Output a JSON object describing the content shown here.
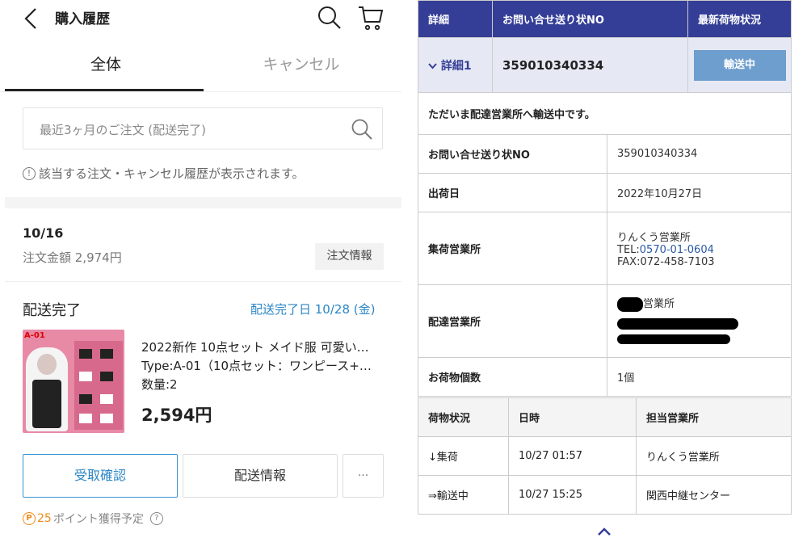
{
  "left": {
    "header": {
      "title": "購入履歴",
      "back_icon": "chevron-left-icon",
      "search_icon": "search-icon",
      "cart_icon": "cart-icon"
    },
    "tabs": [
      {
        "label": "全体",
        "active": true
      },
      {
        "label": "キャンセル",
        "active": false
      }
    ],
    "search": {
      "placeholder": "最近3ヶ月のご注文 (配送完了)"
    },
    "notice": {
      "icon_text": "!",
      "text": "該当する注文・キャンセル履歴が表示されます。"
    },
    "order": {
      "date": "10/16",
      "amount": "注文金額 2,974円",
      "info_button": "注文情報",
      "status": "配送完了",
      "delivery_date": "配送完了日 10/28 (金)",
      "product": {
        "image_label": "A-01",
        "title": "2022新作 10点セット メイド服 可愛い…",
        "type": "Type:A-01（10点セット：ワンピース+…",
        "qty": "数量:2",
        "price": "2,594円"
      },
      "buttons": {
        "receive": "受取確認",
        "shipping": "配送情報",
        "more": "···"
      },
      "points": {
        "badge": "P",
        "number": "25",
        "text": "ポイント獲得予定",
        "help": "?"
      }
    },
    "colors": {
      "accent": "#2a86c5",
      "points": "#f08a1a"
    }
  },
  "right": {
    "header": {
      "col1": "詳細",
      "col2": "お問い合せ送り状NO",
      "col3": "最新荷物状況"
    },
    "detail_row": {
      "link": "詳細1",
      "tracking_no": "359010340334",
      "status_button": "輸送中"
    },
    "message": "ただいま配達営業所へ輸送中です。",
    "info": {
      "inquiry_label": "お問い合せ送り状NO",
      "inquiry_value": "359010340334",
      "ship_date_label": "出荷日",
      "ship_date_value": "2022年10月27日",
      "collect_office_label": "集荷営業所",
      "collect_office_name": "りんくう営業所",
      "collect_office_tel_prefix": "TEL:",
      "collect_office_tel": "0570-01-0604",
      "collect_office_fax": "FAX:072-458-7103",
      "deliver_office_label": "配達営業所",
      "deliver_office_suffix": "営業所",
      "count_label": "お荷物個数",
      "count_value": "1個"
    },
    "history": {
      "headers": [
        "荷物状況",
        "日時",
        "担当営業所"
      ],
      "rows": [
        [
          "↓集荷",
          "10/27 01:57",
          "りんくう営業所"
        ],
        [
          "⇒輸送中",
          "10/27 15:25",
          "関西中継センター"
        ]
      ]
    },
    "colors": {
      "header_bg": "#343e96",
      "detail_bg": "#e6e9f4",
      "button_bg": "#6e9ece"
    }
  }
}
